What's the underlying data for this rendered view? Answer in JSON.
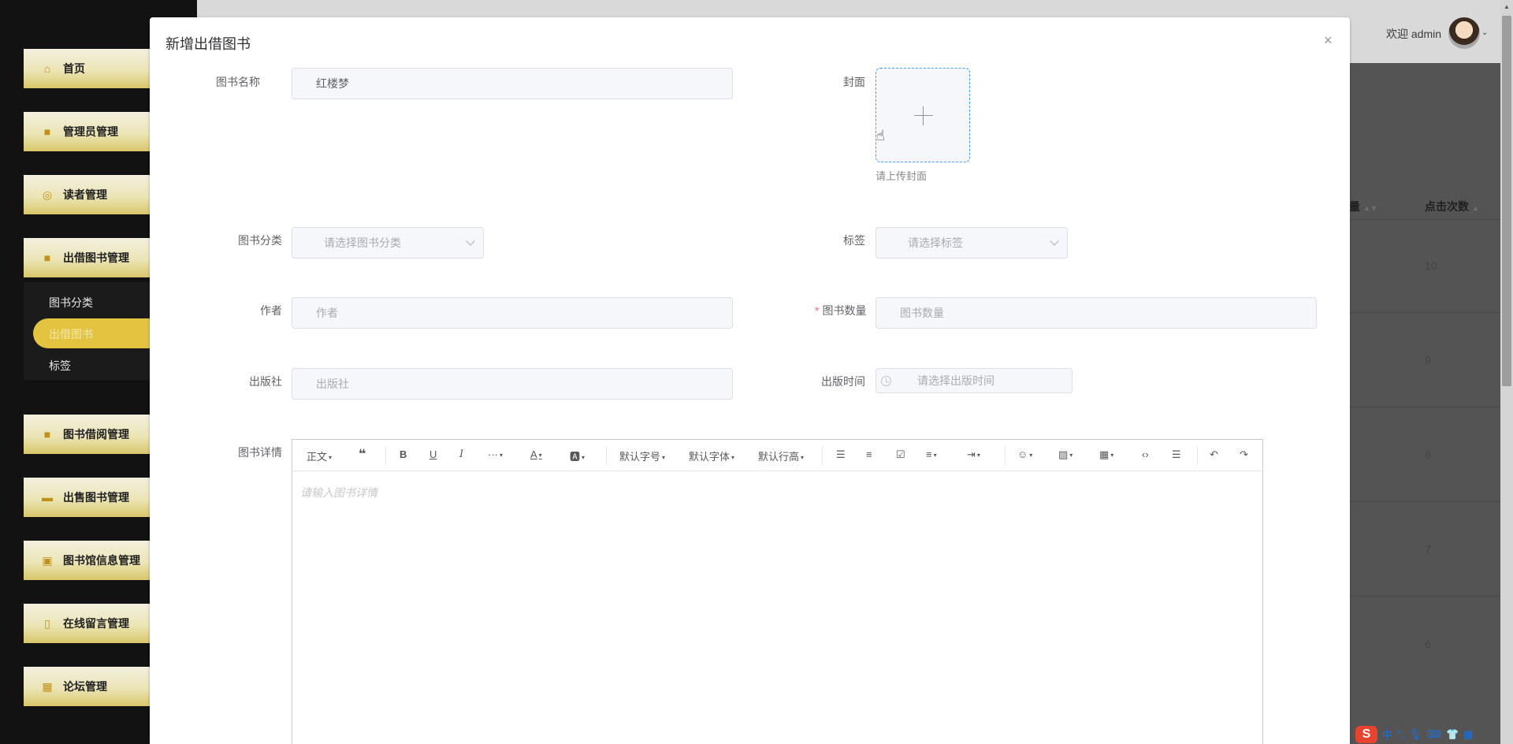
{
  "sidebar": {
    "items": [
      {
        "label": "首页",
        "icon": "home-icon"
      },
      {
        "label": "管理员管理",
        "icon": "admin-icon"
      },
      {
        "label": "读者管理",
        "icon": "reader-icon"
      },
      {
        "label": "出借图书管理",
        "icon": "lend-book-icon"
      },
      {
        "label": "图书借阅管理",
        "icon": "borrow-icon"
      },
      {
        "label": "出售图书管理",
        "icon": "sale-icon"
      },
      {
        "label": "图书馆信息管理",
        "icon": "library-icon"
      },
      {
        "label": "在线留言管理",
        "icon": "message-icon"
      },
      {
        "label": "论坛管理",
        "icon": "forum-icon"
      }
    ],
    "submenu": [
      {
        "label": "图书分类"
      },
      {
        "label": "出借图书"
      },
      {
        "label": "标签"
      }
    ],
    "active_submenu": "出借图书",
    "accent_color": "#e3c340"
  },
  "header": {
    "welcome": "欢迎 admin"
  },
  "table": {
    "columns": [
      "量",
      "点击次数"
    ],
    "click_counts": [
      "10",
      "9",
      "8",
      "7",
      "6"
    ]
  },
  "dialog": {
    "title": "新增出借图书",
    "close_label": "×",
    "fields": {
      "book_name": {
        "label": "图书名称",
        "value": "红楼梦"
      },
      "cover": {
        "label": "封面",
        "tip": "请上传封面"
      },
      "category": {
        "label": "图书分类",
        "placeholder": "请选择图书分类"
      },
      "tag": {
        "label": "标签",
        "placeholder": "请选择标签"
      },
      "author": {
        "label": "作者",
        "placeholder": "作者"
      },
      "quantity": {
        "label": "图书数量",
        "required_mark": "*",
        "placeholder": "图书数量"
      },
      "publisher": {
        "label": "出版社",
        "placeholder": "出版社"
      },
      "publish_time": {
        "label": "出版时间",
        "placeholder": "请选择出版时间"
      },
      "details": {
        "label": "图书详情",
        "placeholder": "请输入图书详情"
      }
    },
    "editor_toolbar": {
      "heading": "正文",
      "font_size": "默认字号",
      "font_family": "默认字体",
      "line_height": "默认行高",
      "more": "···"
    }
  },
  "ime": {
    "lang": "中"
  }
}
